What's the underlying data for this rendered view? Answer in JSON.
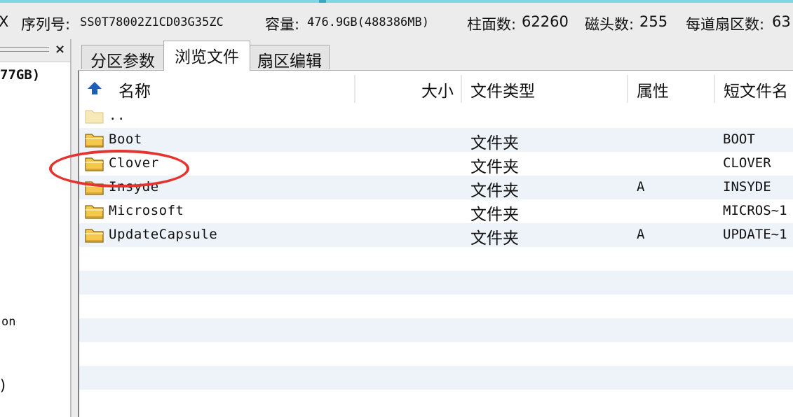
{
  "disk_info": {
    "left_fragment": "X",
    "serial_label": "序列号:",
    "serial_value": "SS0T78002Z1CD03G35ZC",
    "capacity_label": "容量:",
    "capacity_value": "476.9GB(488386MB)",
    "cylinders_label": "柱面数:",
    "cylinders_value": "62260",
    "heads_label": "磁头数:",
    "heads_value": "255",
    "sectors_label": "每道扇区数:",
    "sectors_value": "63"
  },
  "left_panel": {
    "close_glyph": "×",
    "size_fragment": "77GB)",
    "on_fragment": "on",
    "paren_fragment": ")"
  },
  "tabs": [
    {
      "label": "分区参数",
      "active": false
    },
    {
      "label": "浏览文件",
      "active": true
    },
    {
      "label": "扇区编辑",
      "active": false
    }
  ],
  "columns": {
    "name": "名称",
    "size": "大小",
    "type": "文件类型",
    "attr": "属性",
    "short": "短文件名"
  },
  "files": [
    {
      "name": "..",
      "type": "",
      "attr": "",
      "short": "",
      "icon": "folder-open-icon"
    },
    {
      "name": "Boot",
      "type": "文件夹",
      "attr": "",
      "short": "BOOT",
      "icon": "folder-icon"
    },
    {
      "name": "Clover",
      "type": "文件夹",
      "attr": "",
      "short": "CLOVER",
      "icon": "folder-icon"
    },
    {
      "name": "Insyde",
      "type": "文件夹",
      "attr": "A",
      "short": "INSYDE",
      "icon": "folder-icon"
    },
    {
      "name": "Microsoft",
      "type": "文件夹",
      "attr": "",
      "short": "MICROS~1",
      "icon": "folder-icon"
    },
    {
      "name": "UpdateCapsule",
      "type": "文件夹",
      "attr": "A",
      "short": "UPDATE~1",
      "icon": "folder-icon"
    }
  ],
  "colors": {
    "row_stripe": "#eef3fa",
    "folder_fill": "#f5c84c",
    "highlight_circle": "#e3342f",
    "sort_arrow": "#1f5fb8"
  }
}
